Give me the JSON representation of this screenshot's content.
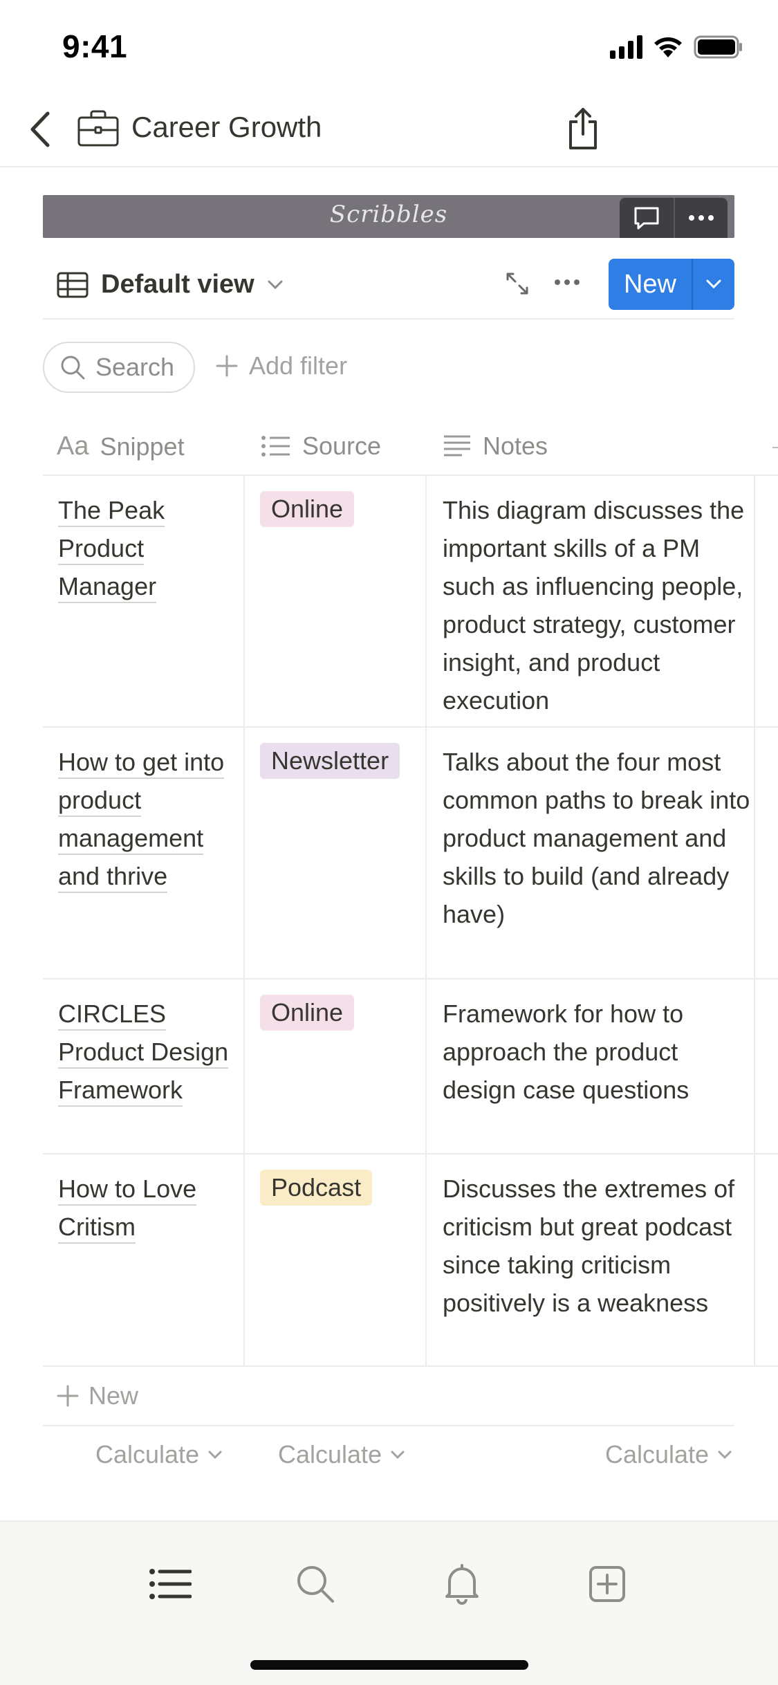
{
  "status_bar": {
    "time": "9:41"
  },
  "navbar": {
    "title": "Career Growth",
    "page_icon": "briefcase-icon"
  },
  "cover": {
    "text": "Scribbles"
  },
  "view": {
    "label": "Default view",
    "new_label": "New"
  },
  "filters": {
    "search_label": "Search",
    "add_filter_label": "Add filter"
  },
  "table": {
    "columns": [
      {
        "label": "Snippet",
        "icon": "Aa"
      },
      {
        "label": "Source",
        "icon": "list-icon"
      },
      {
        "label": "Notes",
        "icon": "text-lines-icon"
      }
    ],
    "rows": [
      {
        "title": "The Peak Product Manager",
        "source": "Online",
        "notes": "This diagram discusses the important skills of a PM such as influencing people, product strategy, customer insight, and product execution"
      },
      {
        "title": "How to get into product management and thrive",
        "source": "Newsletter",
        "notes": "Talks about the four most common paths to break into product management and skills to build (and already have)"
      },
      {
        "title": "CIRCLES Product Design Framework",
        "source": "Online",
        "notes": "Framework for how to approach the product design case questions"
      },
      {
        "title": "How to Love Critism",
        "source": "Podcast",
        "notes": "Discusses the extremes of criticism but great podcast since taking criticism positively is a weakness"
      }
    ],
    "add_row_label": "New",
    "calculate_label": "Calculate"
  },
  "colors": {
    "accent": "#2f7ee6",
    "tag_online": "#f5e0e9",
    "tag_newsletter": "#e8deee",
    "tag_podcast": "#fbecc8"
  },
  "tabbar": [
    "list-icon",
    "search-icon",
    "bell-icon",
    "new-page-icon"
  ]
}
